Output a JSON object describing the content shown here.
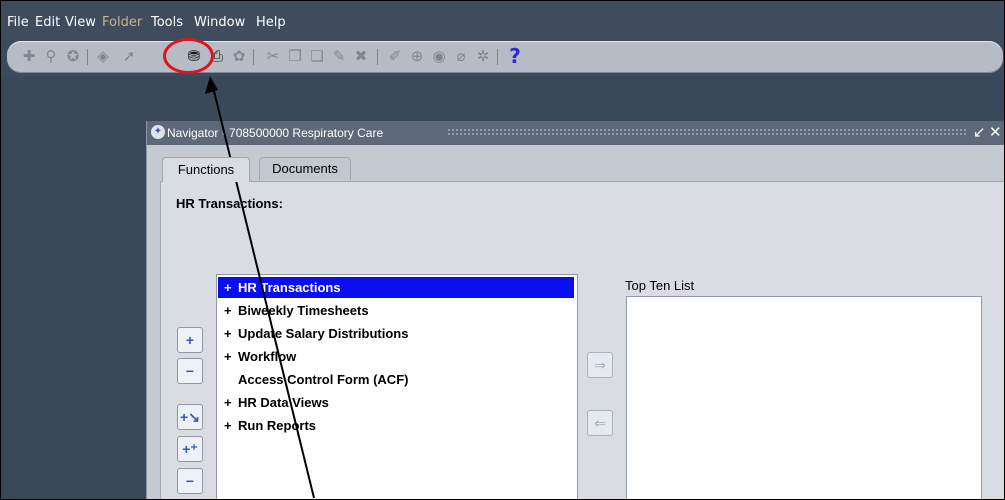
{
  "menubar": {
    "items": [
      {
        "label": "File",
        "enabled": true
      },
      {
        "label": "Edit",
        "enabled": true
      },
      {
        "label": "View",
        "enabled": true
      },
      {
        "label": "Folder",
        "enabled": false
      },
      {
        "label": "Tools",
        "enabled": true
      },
      {
        "label": "Window",
        "enabled": true
      },
      {
        "label": "Help",
        "enabled": true
      }
    ]
  },
  "toolbar": {
    "icons": [
      "new-icon",
      "find-icon",
      "show-navigator-icon",
      "save-icon",
      "next-step-icon",
      "switch-responsibility-icon",
      "print-icon",
      "close-form-icon",
      "cut-icon",
      "copy-icon",
      "paste-icon",
      "clear-record-icon",
      "delete-record-icon",
      "edit-field-icon",
      "zoom-icon",
      "translations-icon",
      "attachments-icon",
      "folder-tools-icon",
      "help-icon"
    ],
    "help_glyph": "?",
    "highlighted_icon": "switch-responsibility-icon",
    "highlight_color": "#e0141c"
  },
  "navigator": {
    "title": "Navigator - 708500000 Respiratory Care",
    "minimize_glyph": "↙",
    "close_glyph": "✕",
    "tabs": [
      {
        "label": "Functions",
        "active": true
      },
      {
        "label": "Documents",
        "active": false
      }
    ],
    "heading": "HR Transactions:",
    "tree_items": [
      {
        "prefix": "+",
        "label": "HR Transactions",
        "selected": true
      },
      {
        "prefix": "+",
        "label": "Biweekly Timesheets",
        "selected": false
      },
      {
        "prefix": "+",
        "label": "Update Salary Distributions",
        "selected": false
      },
      {
        "prefix": "+",
        "label": "Workflow",
        "selected": false
      },
      {
        "prefix": "",
        "label": "Access Control Form (ACF)",
        "selected": false
      },
      {
        "prefix": "+",
        "label": "HR Data Views",
        "selected": false
      },
      {
        "prefix": "+",
        "label": "Run Reports",
        "selected": false
      }
    ],
    "side_buttons": [
      {
        "name": "expand-button",
        "glyph": "+"
      },
      {
        "name": "collapse-button",
        "glyph": "−"
      },
      {
        "name": "expand-branch-button",
        "glyph": "+↘"
      },
      {
        "name": "expand-all-button",
        "glyph": "+⁺"
      },
      {
        "name": "collapse-all-button",
        "glyph": "−"
      }
    ],
    "move_buttons": {
      "add": "⇒",
      "remove": "⇐"
    },
    "top_ten_label": "Top Ten List",
    "selection_color": "#0a0ff2"
  },
  "annotation": {
    "arrow_color": "#000000"
  }
}
